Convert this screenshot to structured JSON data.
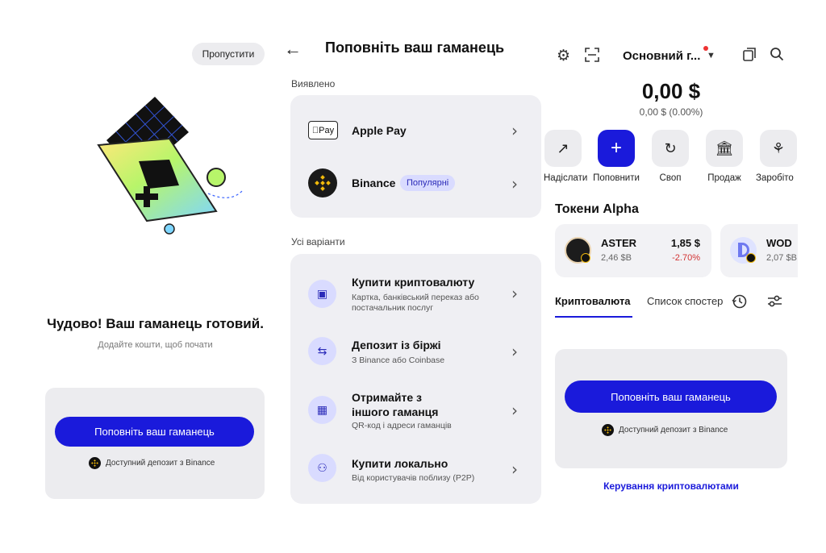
{
  "colors": {
    "accent": "#1a1adb",
    "negative": "#d23333",
    "badge_bg": "#d9dbff",
    "card_bg": "#ececef"
  },
  "onboarding": {
    "skip_label": "Пропустити",
    "title": "Чудово! Ваш гаманець готовий.",
    "subtitle": "Додайте кошти, щоб почати",
    "cta_label": "Поповніть ваш гаманець",
    "deposit_note": "Доступний депозит з Binance"
  },
  "topup": {
    "title": "Поповніть ваш гаманець",
    "found_section": "Виявлено",
    "found_items": [
      {
        "label": "Apple Pay",
        "icon": "apple-pay-icon",
        "icon_text": "Pay"
      },
      {
        "label": "Binance",
        "icon": "binance-icon",
        "badge": "Популярні"
      }
    ],
    "all_section": "Усі варіанти",
    "all_items": [
      {
        "title": "Купити криптовалюту",
        "subtitle_line1": "Картка, банківський переказ або",
        "subtitle_line2": "постачальник послуг",
        "icon": "card-icon"
      },
      {
        "title": "Депозит із біржі",
        "subtitle_line1": "З Binance або Coinbase",
        "subtitle_line2": "",
        "icon": "transfer-icon"
      },
      {
        "title_line1": "Отримайте з",
        "title_line2": "іншого гаманця",
        "subtitle_line1": "QR-код і адреси гаманців",
        "subtitle_line2": "",
        "icon": "qr-icon"
      },
      {
        "title": "Купити локально",
        "subtitle_line1": "Від користувачів поблизу (P2P)",
        "subtitle_line2": "",
        "icon": "people-icon"
      }
    ]
  },
  "wallet": {
    "name": "Основний г...",
    "balance": "0,00 $",
    "balance_sub": "0,00 $ (0.00%)",
    "actions": [
      {
        "label": "Надіслати",
        "icon": "arrow-up-right-icon"
      },
      {
        "label": "Поповнити",
        "icon": "plus-icon"
      },
      {
        "label": "Своп",
        "icon": "swap-icon"
      },
      {
        "label": "Продаж",
        "icon": "bank-icon"
      },
      {
        "label": "Заробіто",
        "icon": "sprout-icon"
      }
    ],
    "alpha_title": "Токени Alpha",
    "tokens": [
      {
        "symbol": "ASTER",
        "price": "1,85 $",
        "volume": "2,46 $B",
        "change": "-2.70%"
      },
      {
        "symbol": "WOD",
        "volume": "2,07 $B"
      }
    ],
    "tabs": [
      "Криптовалюта",
      "Список спостереження"
    ],
    "cta_label": "Поповніть ваш гаманець",
    "deposit_note": "Доступний депозит з Binance",
    "manage_link": "Керування криптовалютами"
  }
}
